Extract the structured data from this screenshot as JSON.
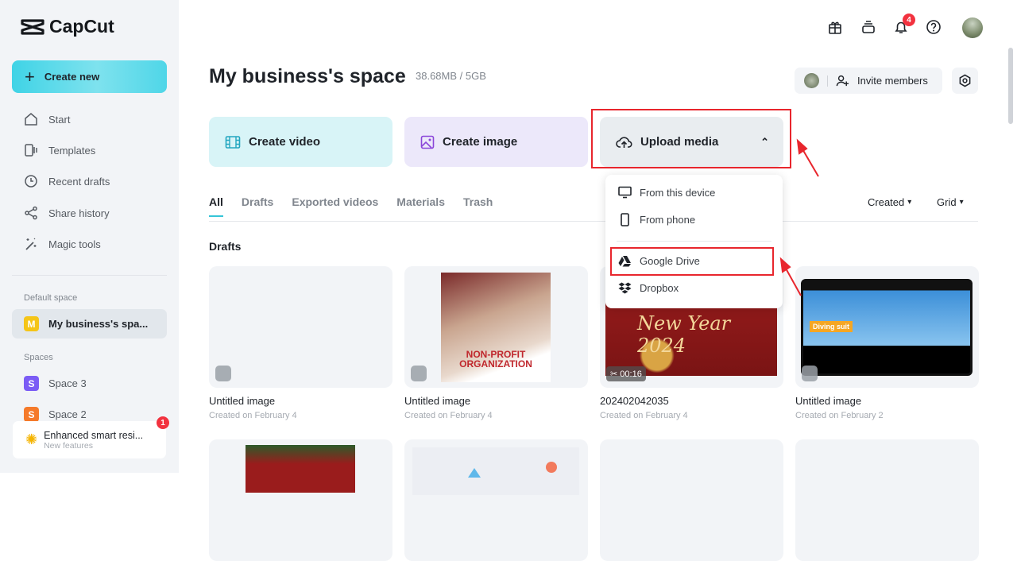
{
  "brand": {
    "name": "CapCut"
  },
  "sidebar": {
    "create_new": "Create new",
    "nav": [
      {
        "label": "Start",
        "icon": "home-icon"
      },
      {
        "label": "Templates",
        "icon": "templates-icon"
      },
      {
        "label": "Recent drafts",
        "icon": "clock-icon"
      },
      {
        "label": "Share history",
        "icon": "share-icon"
      },
      {
        "label": "Magic tools",
        "icon": "magic-wand-icon"
      }
    ],
    "default_space_label": "Default space",
    "default_space": {
      "letter": "M",
      "name": "My business's spa...",
      "color": "#f5c518"
    },
    "spaces_label": "Spaces",
    "spaces": [
      {
        "letter": "S",
        "name": "Space 3",
        "color": "#7b5cf5"
      },
      {
        "letter": "S",
        "name": "Space 2",
        "color": "#f57a2a"
      }
    ],
    "promo": {
      "title": "Enhanced smart resi...",
      "subtitle": "New features",
      "badge": "1"
    }
  },
  "header": {
    "notification_count": "4"
  },
  "main": {
    "title": "My business's space",
    "storage": "38.68MB / 5GB",
    "invite": "Invite members",
    "cards": [
      {
        "label": "Create video",
        "bg": "#d8f4f7"
      },
      {
        "label": "Create image",
        "bg": "#ece8fa"
      },
      {
        "label": "Upload media",
        "bg": "#e9edf0"
      }
    ],
    "upload_menu": [
      "From this device",
      "From phone",
      "Google Drive",
      "Dropbox"
    ],
    "tabs": [
      "All",
      "Drafts",
      "Exported videos",
      "Materials",
      "Trash"
    ],
    "sort": "Created",
    "view": "Grid",
    "section": "Drafts",
    "drafts": [
      {
        "name": "Untitled image",
        "date": "Created on February 4"
      },
      {
        "name": "Untitled image",
        "date": "Created on February 4",
        "thumb_text": "NON-PROFIT ORGANIZATION"
      },
      {
        "name": "202402042035",
        "date": "Created on February 4",
        "duration": "00:16",
        "thumb_text": "New Year 2024"
      },
      {
        "name": "Untitled image",
        "date": "Created on February 2",
        "thumb_text": "Diving suit"
      }
    ]
  }
}
